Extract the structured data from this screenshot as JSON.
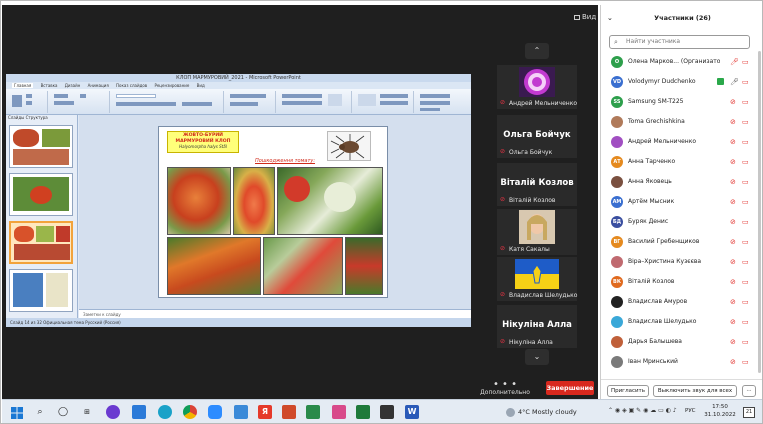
{
  "meeting": {
    "view_label": "Вид",
    "more_label": "Дополнительно",
    "end_label": "Завершение"
  },
  "powerpoint": {
    "window_title": "КЛОП МАРМУРОВИЙ_2021 - Microsoft PowerPoint",
    "tabs": [
      "Главная",
      "Вставка",
      "Дизайн",
      "Анимация",
      "Показ слайдов",
      "Рецензирование",
      "Вид"
    ],
    "left_tabs": "Слайды  Структура",
    "notes_placeholder": "Заметки к слайду",
    "status": "Слайд 14 из 32   Официальная тема   Русский (Россия)",
    "slide": {
      "title_line1": "ЖОВТО-БУРИЙ",
      "title_line2": "МАРМУРОВИЙ КЛОП",
      "latin": "Halyomorpha halys Stål",
      "damage_caption": "Пошкодження томату:"
    }
  },
  "strip": {
    "tiles": [
      {
        "name": "Андрей Мельниченко",
        "big": ""
      },
      {
        "name": "Ольга Бойчук",
        "big": "Ольга Бойчук"
      },
      {
        "name": "Віталій Козлов",
        "big": "Віталій Козлов"
      },
      {
        "name": "Катя Сакалы",
        "big": ""
      },
      {
        "name": "Владислав Шелудько",
        "big": ""
      },
      {
        "name": "Нікуліна Алла",
        "big": "Нікуліна Алла"
      }
    ]
  },
  "panel": {
    "title": "Участники (26)",
    "search_placeholder": "Найти участника",
    "invite_label": "Пригласить",
    "mute_all_label": "Выключить звук для всех",
    "participants": [
      {
        "initials": "О",
        "color": "#2e9f4c",
        "name": "Олена Марков... (Организатор, я)"
      },
      {
        "initials": "VD",
        "color": "#3a6fd0",
        "name": "Volodymyr Dudchenko"
      },
      {
        "initials": "SS",
        "color": "#2e9f4c",
        "name": "Samsung SM-T225"
      },
      {
        "initials": "",
        "color": "#b07a5a",
        "name": "Toma Grechishkina"
      },
      {
        "initials": "",
        "color": "#a14fc2",
        "name": "Андрей Мельниченко"
      },
      {
        "initials": "АТ",
        "color": "#e58a1f",
        "name": "Анна Тарченко"
      },
      {
        "initials": "",
        "color": "#7a5040",
        "name": "Анна Яковець"
      },
      {
        "initials": "АМ",
        "color": "#3a6fd0",
        "name": "Артём Мысник"
      },
      {
        "initials": "БД",
        "color": "#3a4fa0",
        "name": "Буряк Денис"
      },
      {
        "initials": "ВГ",
        "color": "#e58a1f",
        "name": "Василий Гребенщиков"
      },
      {
        "initials": "",
        "color": "#c06a70",
        "name": "Віра–Христина Кузєєва"
      },
      {
        "initials": "ВК",
        "color": "#e06a1f",
        "name": "Віталій Козлов"
      },
      {
        "initials": "",
        "color": "#222222",
        "name": "Владислав Амуров"
      },
      {
        "initials": "",
        "color": "#3aa8d8",
        "name": "Владислав Шелудько"
      },
      {
        "initials": "",
        "color": "#c0603a",
        "name": "Дарья Балышева"
      },
      {
        "initials": "",
        "color": "#7a7a7a",
        "name": "Іван Мринський"
      }
    ]
  },
  "taskbar": {
    "weather": "4°C  Mostly cloudy",
    "lang": "РУС",
    "time": "17:50",
    "date": "31.10.2022",
    "notifications": "21"
  }
}
